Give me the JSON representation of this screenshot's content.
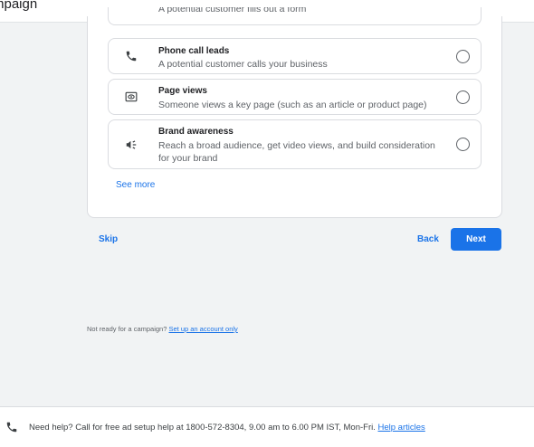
{
  "header": {
    "title": "mpaign"
  },
  "goals": {
    "partial_desc": "A potential customer fills out a form",
    "options": [
      {
        "title": "Phone call leads",
        "desc": "A potential customer calls your business",
        "icon": "phone-icon"
      },
      {
        "title": "Page views",
        "desc": "Someone views a key page (such as an article or product page)",
        "icon": "page-view-icon"
      },
      {
        "title": "Brand awareness",
        "desc": "Reach a broad audience, get video views, and build consideration for your brand",
        "icon": "megaphone-icon"
      }
    ],
    "see_more": "See more"
  },
  "actions": {
    "skip": "Skip",
    "back": "Back",
    "next": "Next"
  },
  "account": {
    "prompt": "Not ready for a campaign?",
    "link": "Set up an account only"
  },
  "footer": {
    "text": "Need help? Call for free ad setup help at 1800-572-8304, 9.00 am to 6.00 PM IST, Mon-Fri.",
    "link": "Help articles",
    "icon": "phone-icon"
  },
  "colors": {
    "accent": "#1a73e8",
    "background": "#f1f3f4"
  }
}
